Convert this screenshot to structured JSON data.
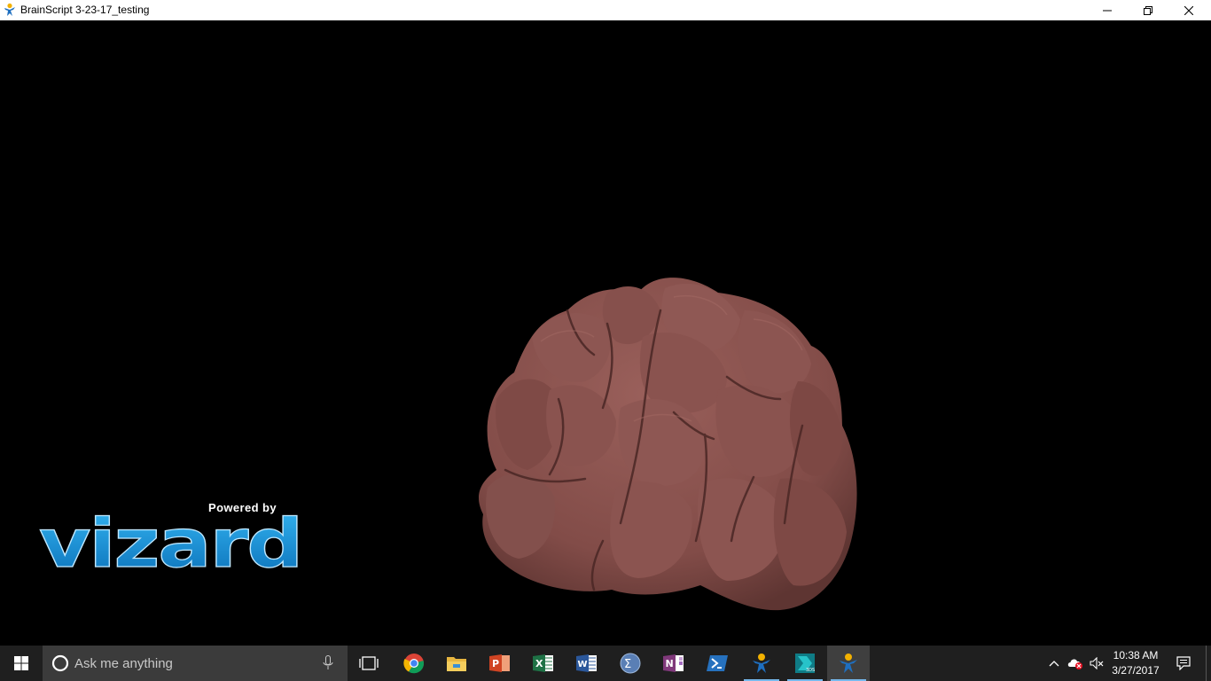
{
  "window": {
    "title": "BrainScript 3-23-17_testing",
    "app_icon": "vizard-app-icon",
    "controls": [
      "minimize-icon",
      "restore-icon",
      "close-icon"
    ]
  },
  "viewport": {
    "background": "#000000",
    "model": "3d-brain-model",
    "model_color": "#8a5450",
    "logo": {
      "powered_by": "Powered by",
      "brand": "vizard",
      "brand_color": "#1a8fd6"
    }
  },
  "taskbar": {
    "background": "#1f1f1f",
    "search": {
      "placeholder": "Ask me anything"
    },
    "apps": [
      {
        "name": "task-view",
        "icon": "task-view-icon"
      },
      {
        "name": "chrome",
        "icon": "chrome-icon"
      },
      {
        "name": "file-explorer",
        "icon": "folder-icon"
      },
      {
        "name": "powerpoint",
        "icon": "powerpoint-icon"
      },
      {
        "name": "excel",
        "icon": "excel-icon"
      },
      {
        "name": "word",
        "icon": "word-icon"
      },
      {
        "name": "sigma-app",
        "icon": "sigma-icon"
      },
      {
        "name": "onenote",
        "icon": "onenote-icon"
      },
      {
        "name": "powershell",
        "icon": "powershell-icon"
      },
      {
        "name": "vizard-1",
        "icon": "vizard-icon",
        "running": true
      },
      {
        "name": "autodesk-3ds",
        "icon": "autodesk-icon",
        "running": true
      },
      {
        "name": "vizard-2",
        "icon": "vizard-icon",
        "running": true,
        "active": true
      }
    ],
    "tray": {
      "time": "10:38 AM",
      "date": "3/27/2017"
    }
  }
}
